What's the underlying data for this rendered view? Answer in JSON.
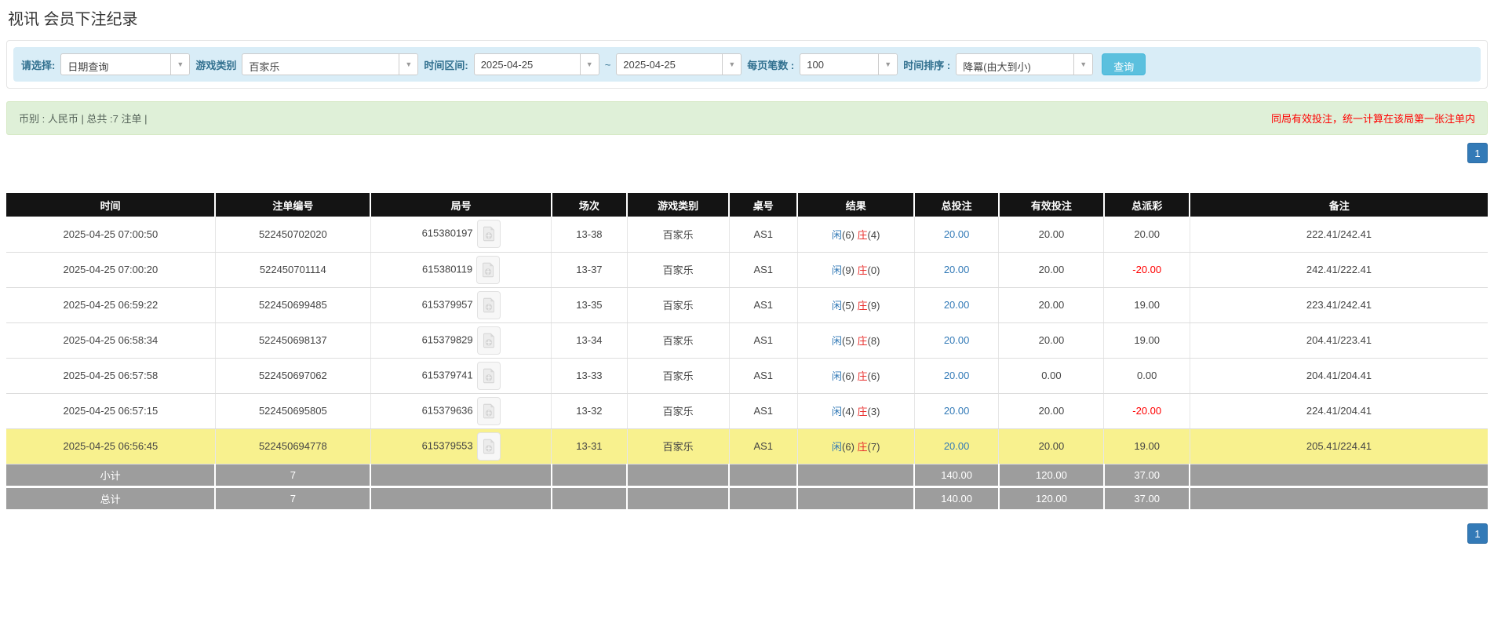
{
  "page": {
    "title": "视讯 会员下注纪录"
  },
  "filters": {
    "select_label": "请选择:",
    "select_value": "日期查询",
    "game_type_label": "游戏类别",
    "game_type_value": "百家乐",
    "time_range_label": "时间区间:",
    "date_from": "2025-04-25",
    "tilde": "~",
    "date_to": "2025-04-25",
    "page_size_label": "每页笔数 :",
    "page_size_value": "100",
    "sort_label": "时间排序 :",
    "sort_value": "降冪(由大到小)",
    "search_button": "查询"
  },
  "summary": {
    "left": "币别 : 人民币 | 总共 :7 注单 |",
    "right_note": "同局有效投注，统一计算在该局第一张注单内"
  },
  "pagination": {
    "page": "1"
  },
  "table": {
    "headers": [
      "时间",
      "注单编号",
      "局号",
      "场次",
      "游戏类别",
      "桌号",
      "结果",
      "总投注",
      "有效投注",
      "总派彩",
      "备注"
    ],
    "rows": [
      {
        "time": "2025-04-25 07:00:50",
        "bet_id": "522450702020",
        "round_id": "615380197",
        "session": "13-38",
        "game": "百家乐",
        "table": "AS1",
        "player": "闲",
        "player_score": "(6)",
        "banker": "庄",
        "banker_score": "(4)",
        "total_bet": "20.00",
        "valid_bet": "20.00",
        "payout": "20.00",
        "note": "222.41/242.41",
        "highlight": false
      },
      {
        "time": "2025-04-25 07:00:20",
        "bet_id": "522450701114",
        "round_id": "615380119",
        "session": "13-37",
        "game": "百家乐",
        "table": "AS1",
        "player": "闲",
        "player_score": "(9)",
        "banker": "庄",
        "banker_score": "(0)",
        "total_bet": "20.00",
        "valid_bet": "20.00",
        "payout": "-20.00",
        "note": "242.41/222.41",
        "highlight": false
      },
      {
        "time": "2025-04-25 06:59:22",
        "bet_id": "522450699485",
        "round_id": "615379957",
        "session": "13-35",
        "game": "百家乐",
        "table": "AS1",
        "player": "闲",
        "player_score": "(5)",
        "banker": "庄",
        "banker_score": "(9)",
        "total_bet": "20.00",
        "valid_bet": "20.00",
        "payout": "19.00",
        "note": "223.41/242.41",
        "highlight": false
      },
      {
        "time": "2025-04-25 06:58:34",
        "bet_id": "522450698137",
        "round_id": "615379829",
        "session": "13-34",
        "game": "百家乐",
        "table": "AS1",
        "player": "闲",
        "player_score": "(5)",
        "banker": "庄",
        "banker_score": "(8)",
        "total_bet": "20.00",
        "valid_bet": "20.00",
        "payout": "19.00",
        "note": "204.41/223.41",
        "highlight": false
      },
      {
        "time": "2025-04-25 06:57:58",
        "bet_id": "522450697062",
        "round_id": "615379741",
        "session": "13-33",
        "game": "百家乐",
        "table": "AS1",
        "player": "闲",
        "player_score": "(6)",
        "banker": "庄",
        "banker_score": "(6)",
        "total_bet": "20.00",
        "valid_bet": "0.00",
        "payout": "0.00",
        "note": "204.41/204.41",
        "highlight": false
      },
      {
        "time": "2025-04-25 06:57:15",
        "bet_id": "522450695805",
        "round_id": "615379636",
        "session": "13-32",
        "game": "百家乐",
        "table": "AS1",
        "player": "闲",
        "player_score": "(4)",
        "banker": "庄",
        "banker_score": "(3)",
        "total_bet": "20.00",
        "valid_bet": "20.00",
        "payout": "-20.00",
        "note": "224.41/204.41",
        "highlight": false
      },
      {
        "time": "2025-04-25 06:56:45",
        "bet_id": "522450694778",
        "round_id": "615379553",
        "session": "13-31",
        "game": "百家乐",
        "table": "AS1",
        "player": "闲",
        "player_score": "(6)",
        "banker": "庄",
        "banker_score": "(7)",
        "total_bet": "20.00",
        "valid_bet": "20.00",
        "payout": "19.00",
        "note": "205.41/224.41",
        "highlight": true
      }
    ],
    "subtotal": {
      "label": "小计",
      "count": "7",
      "total_bet": "140.00",
      "valid_bet": "120.00",
      "payout": "37.00"
    },
    "total": {
      "label": "总计",
      "count": "7",
      "total_bet": "140.00",
      "valid_bet": "120.00",
      "payout": "37.00"
    }
  },
  "icons": {
    "video_record": "video-record-icon",
    "dropdown": "chevron-down-icon"
  },
  "colors": {
    "filter_bar_bg": "#d9edf7",
    "filter_label": "#31708f",
    "search_button_bg": "#5bc0de",
    "summary_bg": "#dff0d8",
    "note_red": "#ff0000",
    "pagination_blue": "#337ab7",
    "header_bg": "#141414",
    "highlight_yellow": "#f8f18e",
    "summary_row_gray": "#9d9d9d",
    "player_blue": "#337ab7",
    "banker_red": "#e8302e"
  }
}
